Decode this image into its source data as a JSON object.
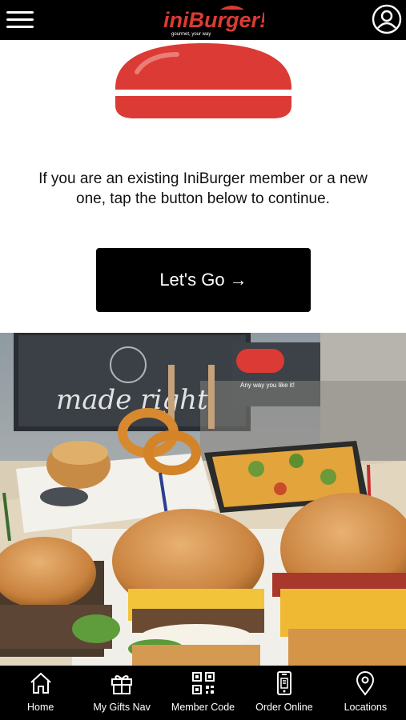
{
  "header": {
    "brand": "iniBurger!",
    "tagline": "gourmet, your way",
    "menu_icon": "hamburger-menu-icon",
    "account_icon": "user-account-icon"
  },
  "main": {
    "intro_text": "If you are an existing IniBurger member or a new one, tap the button below to continue.",
    "cta_label": "Let's Go →"
  },
  "photo": {
    "sign_text": "made right",
    "sign2_text": "Any way you like it!"
  },
  "bottom_nav": {
    "items": [
      {
        "label": "Home",
        "icon": "home-icon"
      },
      {
        "label": "My Gifts Nav",
        "icon": "gift-icon"
      },
      {
        "label": "Member Code",
        "icon": "qr-code-icon"
      },
      {
        "label": "Order Online",
        "icon": "phone-order-icon"
      },
      {
        "label": "Locations",
        "icon": "location-pin-icon"
      }
    ]
  },
  "colors": {
    "brand_red": "#dc3a34",
    "bar_black": "#000000",
    "cta_bg": "#000000"
  }
}
